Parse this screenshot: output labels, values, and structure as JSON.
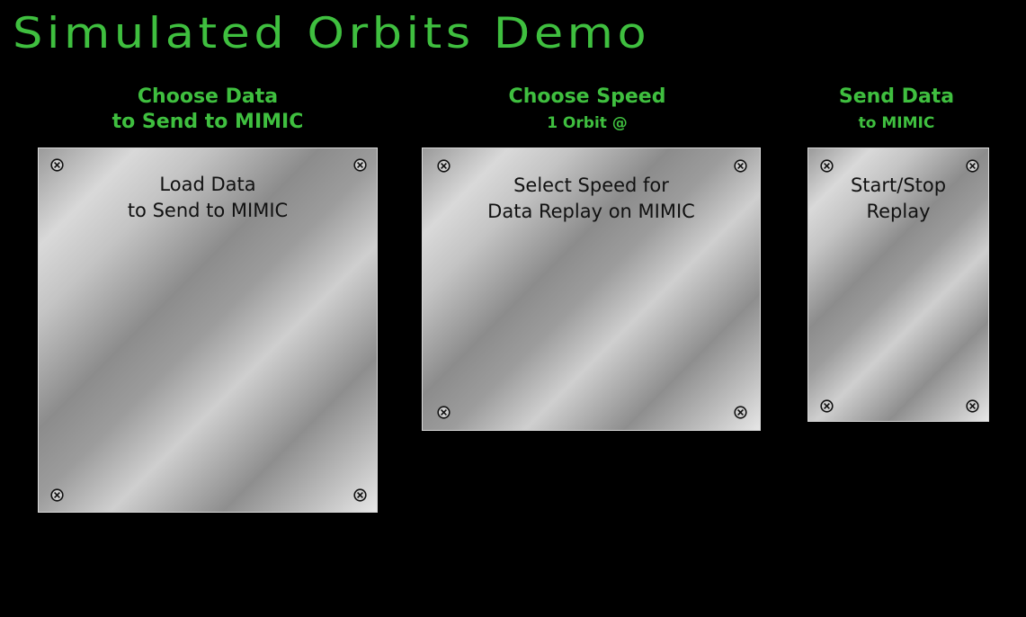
{
  "title": "Simulated Orbits Demo",
  "sections": [
    {
      "header_line1": "Choose Data",
      "header_line2": "to Send to MIMIC",
      "panel_line1": "Load Data",
      "panel_line2": "to Send to MIMIC"
    },
    {
      "header_line1": "Choose Speed",
      "header_line2": "1 Orbit @",
      "panel_line1": "Select Speed for",
      "panel_line2": "Data Replay on MIMIC"
    },
    {
      "header_line1": "Send Data",
      "header_line2": "to MIMIC",
      "panel_line1": "Start/Stop",
      "panel_line2": "Replay"
    }
  ],
  "icons": {
    "screw": "screw-icon"
  },
  "colors": {
    "background": "#000000",
    "accent_green": "#3fbf3f",
    "panel_text": "#111111"
  }
}
